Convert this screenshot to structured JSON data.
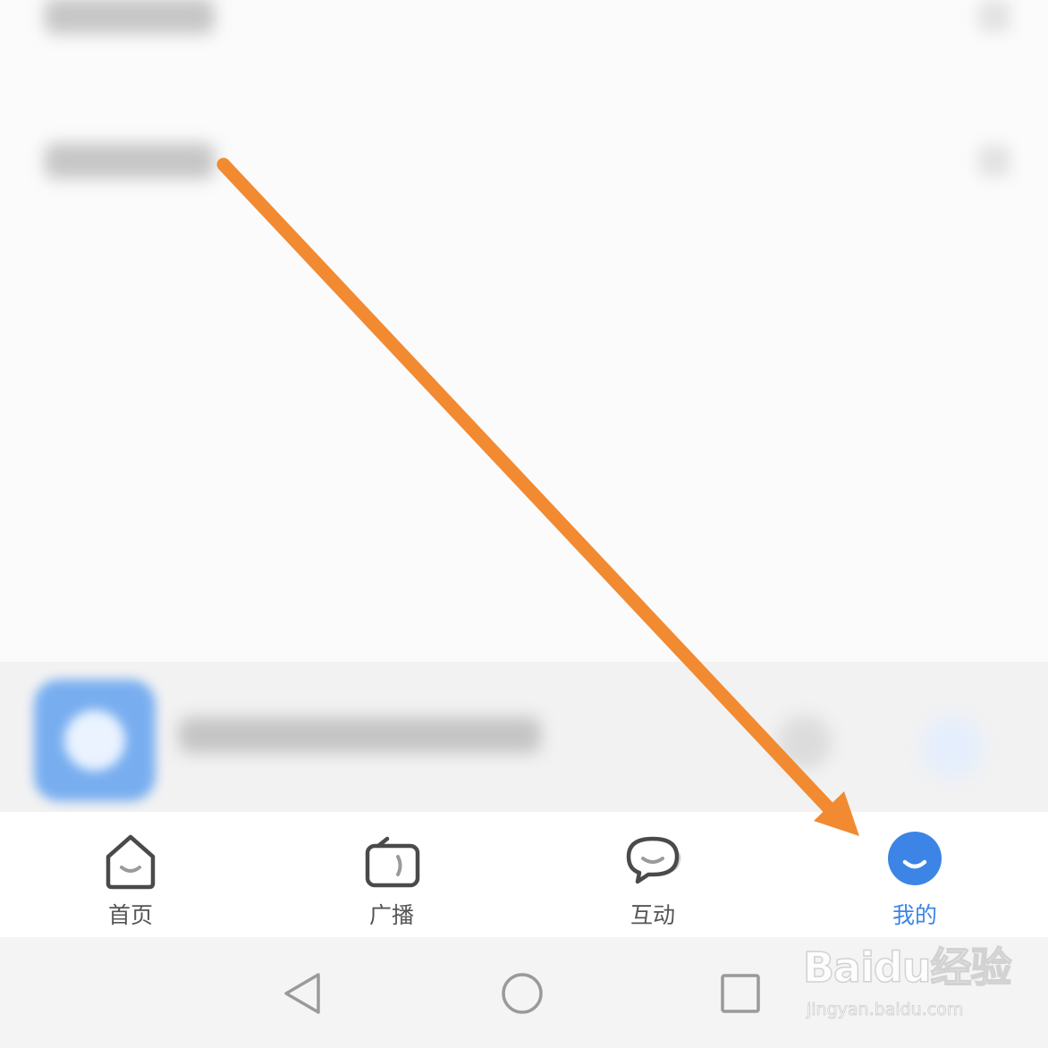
{
  "tabs": [
    {
      "label": "首页",
      "icon": "home-icon",
      "active": false
    },
    {
      "label": "广播",
      "icon": "radio-icon",
      "active": false
    },
    {
      "label": "互动",
      "icon": "chat-icon",
      "active": false
    },
    {
      "label": "我的",
      "icon": "profile-icon",
      "active": true
    }
  ],
  "system_nav": {
    "back": "back-icon",
    "home": "home-circle-icon",
    "recents": "recents-icon"
  },
  "watermark": {
    "logo": "Baidu经验",
    "url": "jingyan.baidu.com"
  },
  "colors": {
    "accent": "#3c85e6",
    "arrow": "#f28a32",
    "tab_inactive": "#555555"
  }
}
